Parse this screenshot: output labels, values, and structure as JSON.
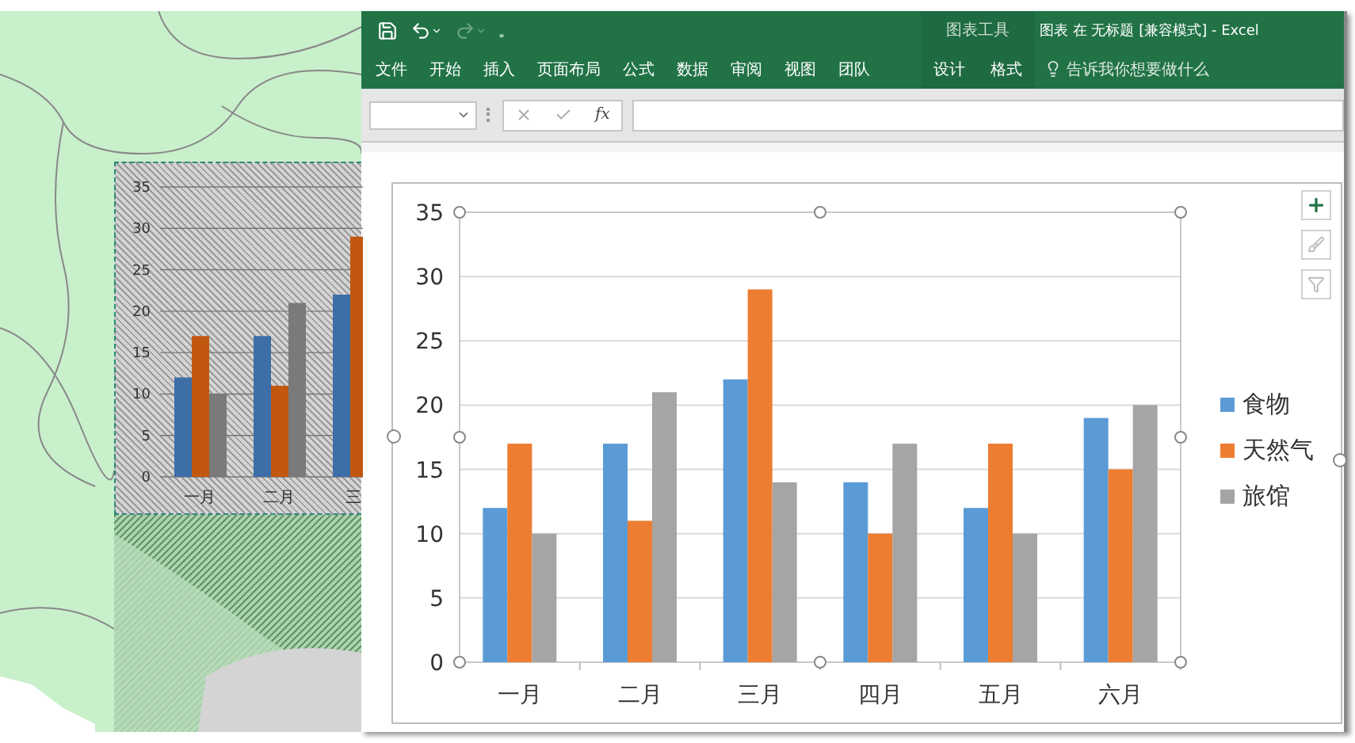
{
  "map_panel": {
    "kind": "picture",
    "overlay_chart": {
      "chart_data": {
        "type": "bar",
        "categories": [
          "一月",
          "二月",
          "三"
        ],
        "ylim": [
          0,
          35
        ],
        "yticks": [
          0,
          5,
          10,
          15,
          20,
          25,
          30,
          35
        ],
        "grid": true,
        "series": [
          {
            "color": "#3d6ea8",
            "values": [
              12,
              17,
              22
            ]
          },
          {
            "color": "#c2570f",
            "values": [
              17,
              11,
              29
            ]
          },
          {
            "color": "#7a7a7a",
            "values": [
              10,
              21,
              null
            ]
          }
        ]
      }
    }
  },
  "excel": {
    "quick_access": {
      "customize": "₌"
    },
    "context_group": "图表工具",
    "title": "图表 在 无标题  [兼容模式]  -  Excel",
    "tabs": [
      {
        "label": "文件",
        "contextual": false
      },
      {
        "label": "开始",
        "contextual": false
      },
      {
        "label": "插入",
        "contextual": false
      },
      {
        "label": "页面布局",
        "contextual": false
      },
      {
        "label": "公式",
        "contextual": false
      },
      {
        "label": "数据",
        "contextual": false
      },
      {
        "label": "审阅",
        "contextual": false
      },
      {
        "label": "视图",
        "contextual": false
      },
      {
        "label": "团队",
        "contextual": false
      },
      {
        "label": "设计",
        "contextual": true
      },
      {
        "label": "格式",
        "contextual": true
      }
    ],
    "tell_me": "告诉我你想要做什么",
    "formula_bar": {
      "insert_function": "fx"
    },
    "chart": {
      "chart_data": {
        "type": "bar",
        "categories": [
          "一月",
          "二月",
          "三月",
          "四月",
          "五月",
          "六月"
        ],
        "ylim": [
          0,
          35
        ],
        "yticks": [
          0,
          5,
          10,
          15,
          20,
          25,
          30,
          35
        ],
        "grid": true,
        "series": [
          {
            "name": "食物",
            "color": "#5b9bd5",
            "values": [
              12,
              17,
              22,
              14,
              12,
              19
            ]
          },
          {
            "name": "天然气",
            "color": "#ed7d31",
            "values": [
              17,
              11,
              29,
              10,
              17,
              15
            ]
          },
          {
            "name": "旅馆",
            "color": "#a5a5a5",
            "values": [
              10,
              21,
              14,
              17,
              10,
              20
            ]
          }
        ]
      }
    }
  }
}
